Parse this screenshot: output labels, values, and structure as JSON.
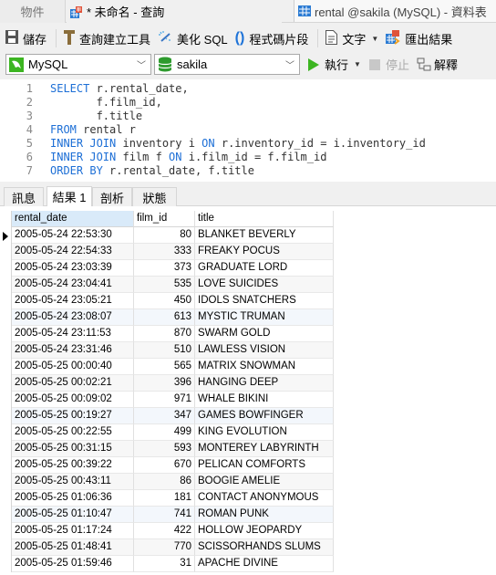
{
  "tabs": {
    "objects": "物件",
    "query": "* 未命名 - 查詢",
    "table": "rental @sakila (MySQL) - 資料表"
  },
  "toolbar": {
    "save": "儲存",
    "query_builder": "查詢建立工具",
    "beautify": "美化 SQL",
    "snippet": "程式碼片段",
    "text": "文字",
    "export": "匯出結果"
  },
  "connection": {
    "conn_value": "MySQL",
    "db_value": "sakila",
    "run": "執行",
    "stop": "停止",
    "explain": "解釋"
  },
  "editor": {
    "lines": [
      {
        "n": "1",
        "segs": [
          {
            "k": true,
            "t": "SELECT"
          },
          {
            "k": false,
            "t": " r.rental_date,"
          }
        ]
      },
      {
        "n": "2",
        "segs": [
          {
            "k": false,
            "t": "       f.film_id,"
          }
        ]
      },
      {
        "n": "3",
        "segs": [
          {
            "k": false,
            "t": "       f.title"
          }
        ]
      },
      {
        "n": "4",
        "segs": [
          {
            "k": true,
            "t": "FROM"
          },
          {
            "k": false,
            "t": " rental r"
          }
        ]
      },
      {
        "n": "5",
        "segs": [
          {
            "k": true,
            "t": "INNER JOIN"
          },
          {
            "k": false,
            "t": " inventory i "
          },
          {
            "k": true,
            "t": "ON"
          },
          {
            "k": false,
            "t": " r.inventory_id = i.inventory_id"
          }
        ]
      },
      {
        "n": "6",
        "segs": [
          {
            "k": true,
            "t": "INNER JOIN"
          },
          {
            "k": false,
            "t": " film f "
          },
          {
            "k": true,
            "t": "ON"
          },
          {
            "k": false,
            "t": " i.film_id = f.film_id"
          }
        ]
      },
      {
        "n": "7",
        "segs": [
          {
            "k": true,
            "t": "ORDER BY"
          },
          {
            "k": false,
            "t": " r.rental_date, f.title"
          }
        ]
      }
    ]
  },
  "result_tabs": [
    "訊息",
    "結果 1",
    "剖析",
    "狀態"
  ],
  "grid": {
    "columns": [
      "rental_date",
      "film_id",
      "title"
    ],
    "rows": [
      [
        "2005-05-24 22:53:30",
        "80",
        "BLANKET BEVERLY"
      ],
      [
        "2005-05-24 22:54:33",
        "333",
        "FREAKY POCUS"
      ],
      [
        "2005-05-24 23:03:39",
        "373",
        "GRADUATE LORD"
      ],
      [
        "2005-05-24 23:04:41",
        "535",
        "LOVE SUICIDES"
      ],
      [
        "2005-05-24 23:05:21",
        "450",
        "IDOLS SNATCHERS"
      ],
      [
        "2005-05-24 23:08:07",
        "613",
        "MYSTIC TRUMAN"
      ],
      [
        "2005-05-24 23:11:53",
        "870",
        "SWARM GOLD"
      ],
      [
        "2005-05-24 23:31:46",
        "510",
        "LAWLESS VISION"
      ],
      [
        "2005-05-25 00:00:40",
        "565",
        "MATRIX SNOWMAN"
      ],
      [
        "2005-05-25 00:02:21",
        "396",
        "HANGING DEEP"
      ],
      [
        "2005-05-25 00:09:02",
        "971",
        "WHALE BIKINI"
      ],
      [
        "2005-05-25 00:19:27",
        "347",
        "GAMES BOWFINGER"
      ],
      [
        "2005-05-25 00:22:55",
        "499",
        "KING EVOLUTION"
      ],
      [
        "2005-05-25 00:31:15",
        "593",
        "MONTEREY LABYRINTH"
      ],
      [
        "2005-05-25 00:39:22",
        "670",
        "PELICAN COMFORTS"
      ],
      [
        "2005-05-25 00:43:11",
        "86",
        "BOOGIE AMELIE"
      ],
      [
        "2005-05-25 01:06:36",
        "181",
        "CONTACT ANONYMOUS"
      ],
      [
        "2005-05-25 01:10:47",
        "741",
        "ROMAN PUNK"
      ],
      [
        "2005-05-25 01:17:24",
        "422",
        "HOLLOW JEOPARDY"
      ],
      [
        "2005-05-25 01:48:41",
        "770",
        "SCISSORHANDS SLUMS"
      ],
      [
        "2005-05-25 01:59:46",
        "31",
        "APACHE DIVINE"
      ]
    ]
  },
  "colors": {
    "keyword": "#1d6fd6",
    "run_green": "#3cb521",
    "db_green": "#2e9b2e",
    "header_selected": "#d9eaf9"
  }
}
